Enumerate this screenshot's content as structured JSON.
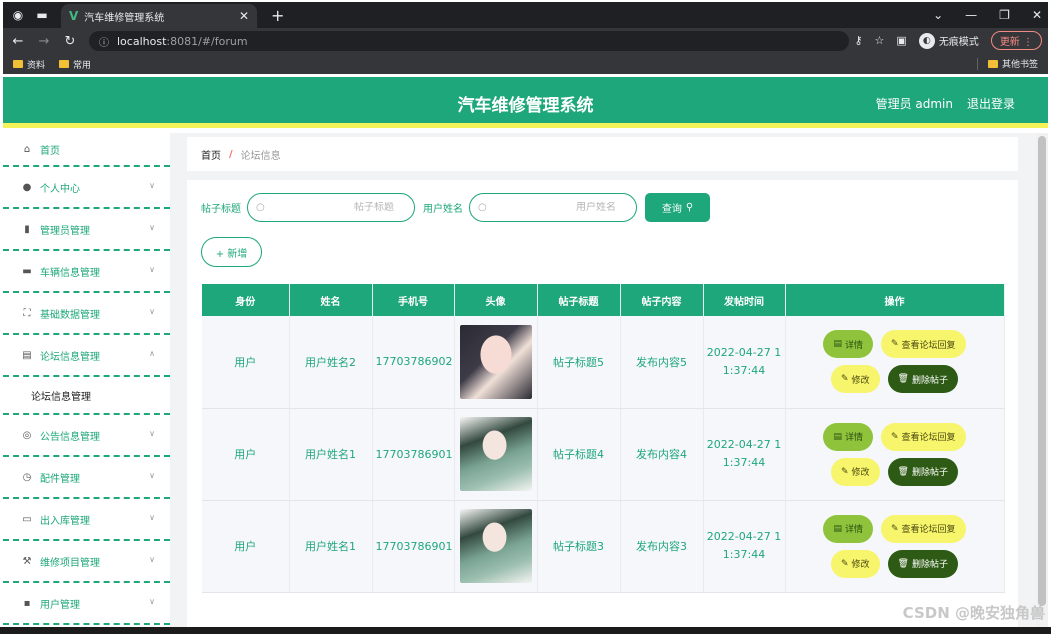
{
  "browser": {
    "tab_title": "汽车维修管理系统",
    "url_host": "localhost",
    "url_path": ":8081/#/forum",
    "incognito_label": "无痕模式",
    "update_label": "更新",
    "bookmarks": [
      "资料",
      "常用"
    ],
    "other_bookmarks": "其他书签"
  },
  "header": {
    "title": "汽车维修管理系统",
    "user": "管理员 admin",
    "logout": "退出登录"
  },
  "sidebar": {
    "items": [
      {
        "label": "首页",
        "icon": "home-icon"
      },
      {
        "label": "个人中心",
        "icon": "user-icon"
      },
      {
        "label": "管理员管理",
        "icon": "bar-chart-icon"
      },
      {
        "label": "车辆信息管理",
        "icon": "suitcase-icon"
      },
      {
        "label": "基础数据管理",
        "icon": "fullscreen-icon"
      },
      {
        "label": "论坛信息管理",
        "icon": "document-icon"
      },
      {
        "label": "论坛信息管理",
        "icon": ""
      },
      {
        "label": "公告信息管理",
        "icon": "compass-icon"
      },
      {
        "label": "配件管理",
        "icon": "clock-icon"
      },
      {
        "label": "出入库管理",
        "icon": "monitor-icon"
      },
      {
        "label": "维修项目管理",
        "icon": "wrench-icon"
      },
      {
        "label": "用户管理",
        "icon": "chat-icon"
      }
    ]
  },
  "breadcrumb": {
    "home": "首页",
    "separator": "/",
    "current": "论坛信息"
  },
  "search": {
    "title_label": "帖子标题",
    "title_placeholder": "帖子标题",
    "name_label": "用户姓名",
    "name_placeholder": "用户姓名",
    "query_label": "查询"
  },
  "add_button": "+ 新增",
  "table": {
    "headers": [
      "身份",
      "姓名",
      "手机号",
      "头像",
      "帖子标题",
      "帖子内容",
      "发帖时间",
      "操作"
    ],
    "rows": [
      {
        "role": "用户",
        "name": "用户姓名2",
        "phone": "17703786902",
        "title": "帖子标题5",
        "content": "发布内容5",
        "time_line1": "2022-04-27 1",
        "time_line2": "1:37:44"
      },
      {
        "role": "用户",
        "name": "用户姓名1",
        "phone": "17703786901",
        "title": "帖子标题4",
        "content": "发布内容4",
        "time_line1": "2022-04-27 1",
        "time_line2": "1:37:44"
      },
      {
        "role": "用户",
        "name": "用户姓名1",
        "phone": "17703786901",
        "title": "帖子标题3",
        "content": "发布内容3",
        "time_line1": "2022-04-27 1",
        "time_line2": "1:37:44"
      }
    ],
    "actions": {
      "detail": "详情",
      "reply": "查看论坛回复",
      "edit": "修改",
      "delete": "删除帖子"
    }
  },
  "watermark": "CSDN @晚安独角兽",
  "colors": {
    "primary": "#1ea77a",
    "header_underline": "#f5f35a",
    "detail_btn": "#8fc33b",
    "yellow_btn": "#f7f56b",
    "delete_btn": "#2d5a14"
  }
}
